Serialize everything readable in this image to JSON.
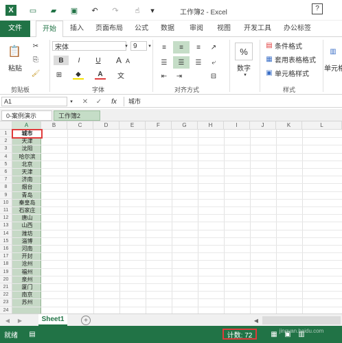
{
  "window": {
    "title": "工作簿2 - Excel",
    "help": "?"
  },
  "ribbon_tabs": [
    "文件",
    "开始",
    "插入",
    "页面布局",
    "公式",
    "数据",
    "审阅",
    "视图",
    "开发工具",
    "办公标签"
  ],
  "clipboard": {
    "paste": "粘贴",
    "group": "剪贴板"
  },
  "font": {
    "name": "宋体",
    "size": "9",
    "bold": "B",
    "italic": "I",
    "underline": "U",
    "font_color_letter": "A",
    "phonetic": "文",
    "group": "字体"
  },
  "alignment": {
    "group": "对齐方式"
  },
  "number": {
    "symbol": "%",
    "label": "数字"
  },
  "styles": {
    "conditional": "条件格式",
    "table_format": "套用表格格式",
    "cell_styles": "单元格样式",
    "group": "样式"
  },
  "cells": {
    "label": "单元格"
  },
  "formula_bar": {
    "name_box": "A1",
    "fx": "fx",
    "content": "城市"
  },
  "workbook_tabs": [
    "0-案例演示",
    "工作簿2"
  ],
  "columns": [
    "A",
    "B",
    "C",
    "D",
    "E",
    "F",
    "G",
    "H",
    "I",
    "J",
    "K",
    "L"
  ],
  "rows": [
    "1",
    "2",
    "3",
    "4",
    "5",
    "6",
    "7",
    "8",
    "9",
    "10",
    "11",
    "12",
    "13",
    "14",
    "15",
    "16",
    "17",
    "18",
    "19",
    "20",
    "21",
    "22",
    "23",
    "24"
  ],
  "column_a": [
    "城市",
    "天津",
    "沈阳",
    "哈尔滨",
    "北京",
    "天津",
    "济南",
    "烟台",
    "青岛",
    "秦皇岛",
    "石家庄",
    "唐山",
    "山西",
    "潍坊",
    "淄博",
    "河南",
    "开封",
    "沧州",
    "福州",
    "泉州",
    "厦门",
    "南京",
    "苏州"
  ],
  "sheet_tab": "Sheet1",
  "status": {
    "ready": "就绪",
    "count": "计数: 72",
    "watermark": "jingyan.baidu.com"
  },
  "colors": {
    "accent": "#217346",
    "highlight": "#e03b3b",
    "selection": "#c6d9c6"
  }
}
